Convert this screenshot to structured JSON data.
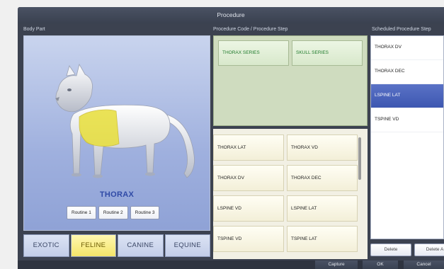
{
  "window": {
    "title": "Procedure"
  },
  "headers": {
    "body_part": "Body Part",
    "procedure": "Procedure Code / Procedure Step",
    "scheduled": "Scheduled Procedure Step"
  },
  "body_part": {
    "selected": "THORAX",
    "routines": [
      "Routine 1",
      "Routine 2",
      "Routine 3"
    ],
    "species": [
      {
        "label": "EXOTIC",
        "active": false
      },
      {
        "label": "FELINE",
        "active": true
      },
      {
        "label": "CANINE",
        "active": false
      },
      {
        "label": "EQUINE",
        "active": false
      }
    ],
    "highlight_color": "#e8df3a"
  },
  "procedure_codes": [
    "THORAX SERIES",
    "SKULL SERIES"
  ],
  "procedure_steps": [
    [
      "THORAX LAT",
      "THORAX VD"
    ],
    [
      "THORAX DV",
      "THORAX DEC"
    ],
    [
      "LSPINE VD",
      "LSPINE LAT"
    ],
    [
      "TSPINE VD",
      "TSPINE LAT"
    ]
  ],
  "scheduled": {
    "items": [
      "THORAX DV",
      "THORAX DEC",
      "LSPINE LAT",
      "TSPINE VD"
    ],
    "selected_index": 2,
    "buttons": {
      "delete": "Delete",
      "delete_all": "Delete A"
    }
  },
  "footer": {
    "capture": "Capture",
    "ok": "OK",
    "cancel": "Cancel"
  }
}
